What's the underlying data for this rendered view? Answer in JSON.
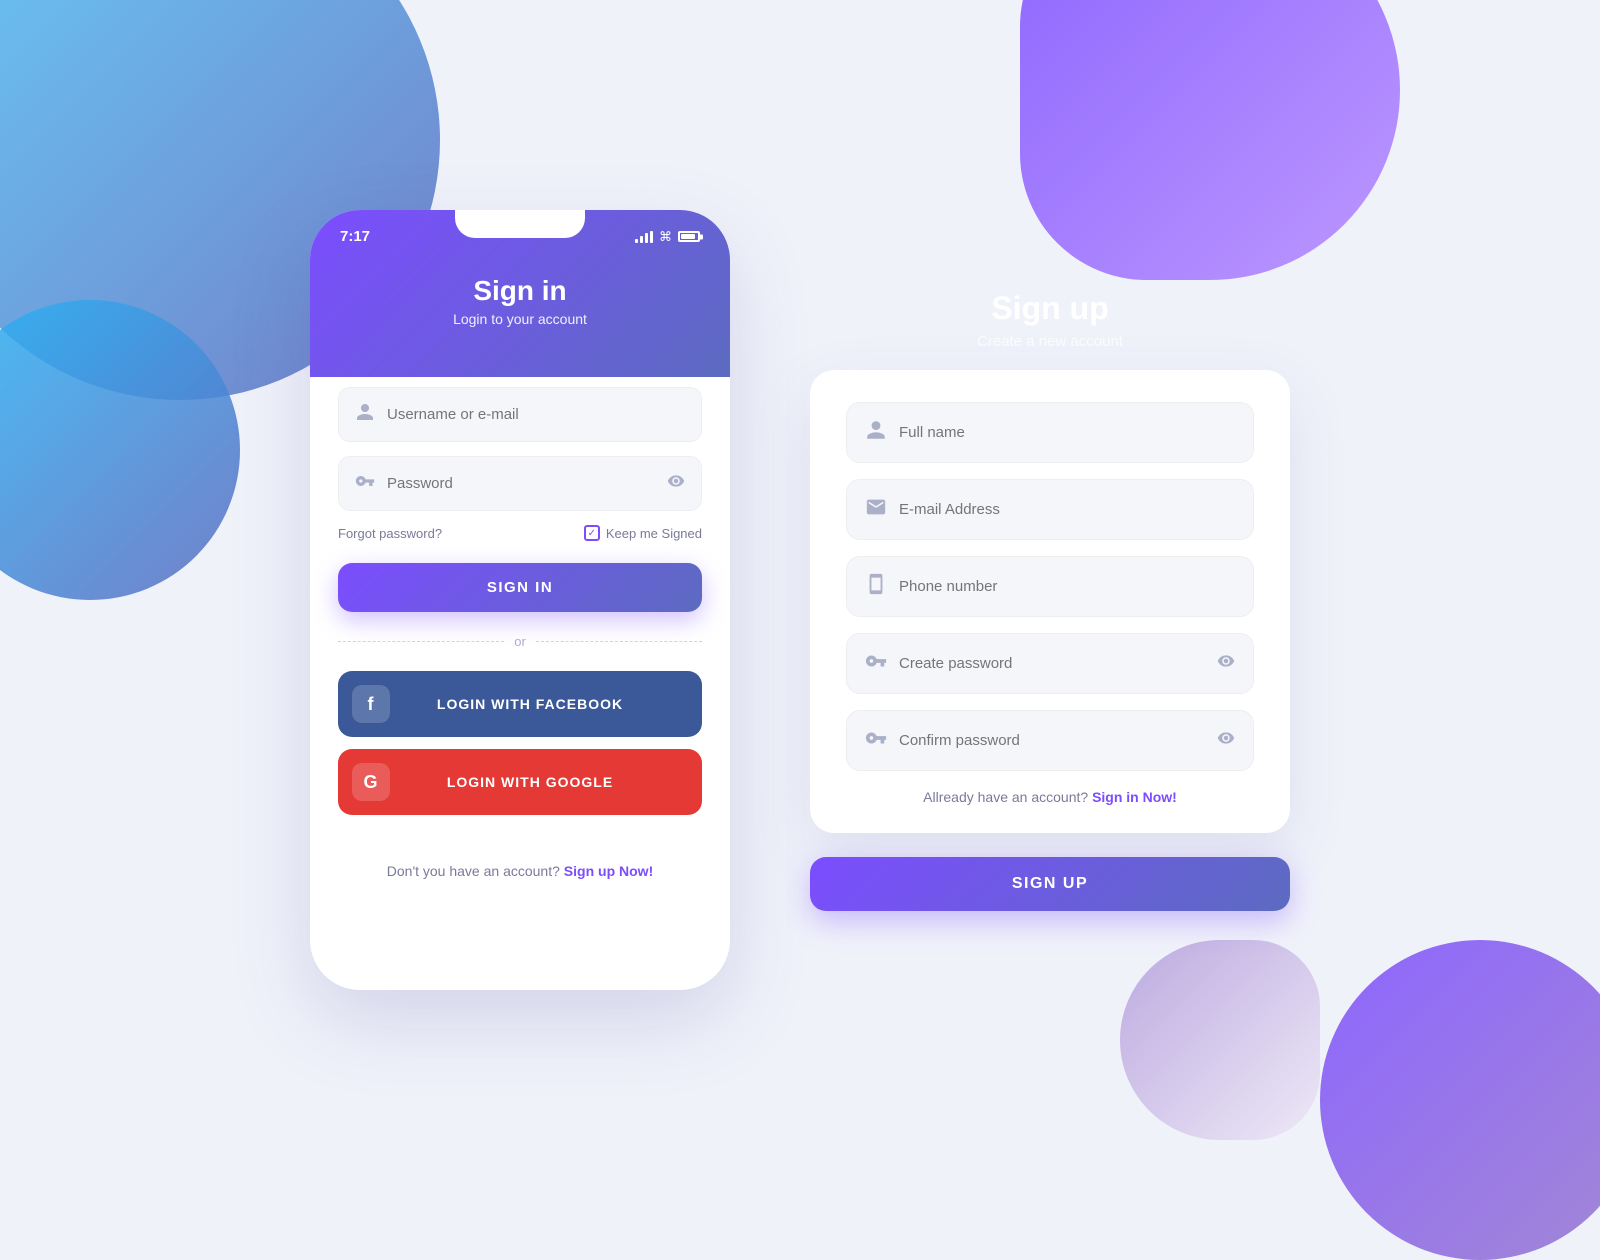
{
  "background": {
    "color": "#f0f2fa"
  },
  "signin": {
    "status_bar": {
      "time": "7:17"
    },
    "title": "Sign in",
    "subtitle": "Login to your account",
    "fields": {
      "username": {
        "placeholder": "Username or e-mail"
      },
      "password": {
        "placeholder": "Password"
      }
    },
    "forgot_label": "Forgot password?",
    "keep_signed_label": "Keep me Signed",
    "sign_in_button": "SIGN IN",
    "divider": "or",
    "facebook_button": "LOGIN WITH FACEBOOK",
    "google_button": "LOGIN WITH GOOGLE",
    "footer_text": "Don't you have an account?",
    "footer_link": "Sign up Now!"
  },
  "signup": {
    "title": "Sign up",
    "subtitle": "Create a new account",
    "fields": {
      "fullname": {
        "placeholder": "Full name"
      },
      "email": {
        "placeholder": "E-mail Address"
      },
      "phone": {
        "placeholder": "Phone number"
      },
      "create_password": {
        "placeholder": "Create password"
      },
      "confirm_password": {
        "placeholder": "Confirm password"
      }
    },
    "already_text": "Allready have an account?",
    "signin_link": "Sign in Now!",
    "signup_button": "SIGN UP"
  },
  "icons": {
    "user": "👤",
    "email": "✉",
    "phone": "📱",
    "key": "🔑",
    "eye": "👁",
    "facebook": "f",
    "google": "G"
  }
}
